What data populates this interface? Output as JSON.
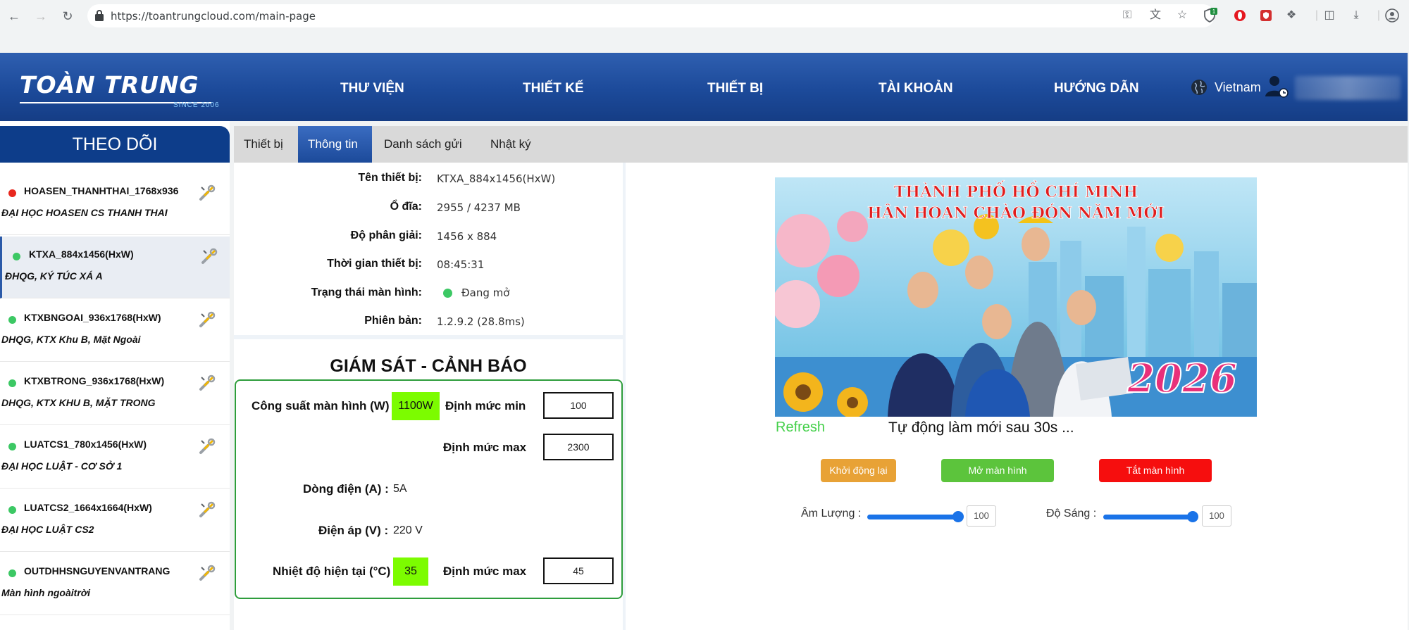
{
  "browser": {
    "url": "https://toantrungcloud.com/main-page",
    "ext_badge": "1"
  },
  "header": {
    "logo_main": "TOÀN TRUNG",
    "logo_since": "SINCE 2006",
    "menu": [
      "THƯ VIỆN",
      "THIẾT KẾ",
      "THIẾT BỊ",
      "TÀI KHOẢN",
      "HƯỚNG DẪN"
    ],
    "country": "Vietnam"
  },
  "sidebar": {
    "title": "THEO DÕI",
    "devices": [
      {
        "name": "HOASEN_THANHTHAI_1768x936",
        "desc": "ĐẠI HỌC HOASEN CS THANH THAI",
        "status_color": "#e8281e",
        "active": false
      },
      {
        "name": "KTXA_884x1456(HxW)",
        "desc": "ĐHQG, KÝ TÚC XÁ A",
        "status_color": "#3cc864",
        "active": true
      },
      {
        "name": "KTXBNGOAI_936x1768(HxW)",
        "desc": "DHQG, KTX Khu B, Mặt Ngoài",
        "status_color": "#3cc864",
        "active": false
      },
      {
        "name": "KTXBTRONG_936x1768(HxW)",
        "desc": "DHQG, KTX KHU B, MẶT TRONG",
        "status_color": "#3cc864",
        "active": false
      },
      {
        "name": "LUATCS1_780x1456(HxW)",
        "desc": "ĐẠI HỌC LUẬT - CƠ SỞ 1",
        "status_color": "#3cc864",
        "active": false
      },
      {
        "name": "LUATCS2_1664x1664(HxW)",
        "desc": "ĐẠI HỌC LUẬT CS2",
        "status_color": "#3cc864",
        "active": false
      },
      {
        "name": "OUTDHHSNGUYENVANTRANG",
        "desc": "Màn hình ngoàitrời",
        "status_color": "#3cc864",
        "active": false
      }
    ]
  },
  "tabs": [
    "Thiết bị",
    "Thông tin",
    "Danh sách gửi",
    "Nhật ký"
  ],
  "info": {
    "device_name_label": "Tên thiết bị:",
    "device_name": "KTXA_884x1456(HxW)",
    "disk_label": "Ổ đĩa:",
    "disk": "2955 / 4237 MB",
    "resolution_label": "Độ phân giải:",
    "resolution": "1456 x 884",
    "time_label": "Thời gian thiết bị:",
    "time": "08:45:31",
    "screen_status_label": "Trạng thái màn hình:",
    "screen_status": "Đang mở",
    "version_label": "Phiên bản:",
    "version": "1.2.9.2 (28.8ms)"
  },
  "monitor": {
    "title": "GIÁM SÁT - CẢNH BÁO",
    "power_label": "Công suất màn hình (W)",
    "power_value": "1100W",
    "min_label": "Định mức min",
    "min_value": "100",
    "max_label": "Định mức max",
    "max_value": "2300",
    "current_label": "Dòng điện (A) :",
    "current_value": "5A",
    "voltage_label": "Điện áp (V) :",
    "voltage_value": "220 V",
    "temp_label": "Nhiệt độ hiện tại (°C)",
    "temp_value": "35",
    "temp_max_label": "Định mức max",
    "temp_max_value": "45"
  },
  "preview": {
    "banner_line1": "THÀNH PHỐ HỒ CHÍ MINH",
    "banner_line2": "HÂN HOAN CHÀO ĐÓN NĂM MỚI",
    "banner_year": "2026",
    "refresh": "Refresh",
    "auto_refresh": "Tự động làm mới sau 30s ..."
  },
  "actions": {
    "restart": "Khởi động lại",
    "screen_on": "Mở màn hình",
    "screen_off": "Tắt màn hình"
  },
  "controls": {
    "volume_label": "Âm Lượng :",
    "volume": "100",
    "brightness_label": "Độ Sáng :",
    "brightness": "100"
  },
  "colors": {
    "header_blue": "#1c4a9a",
    "restart_btn": "#e8a236",
    "on_btn": "#5cc43c",
    "off_btn": "#f60e0e",
    "alert_green": "#7cfc00"
  }
}
